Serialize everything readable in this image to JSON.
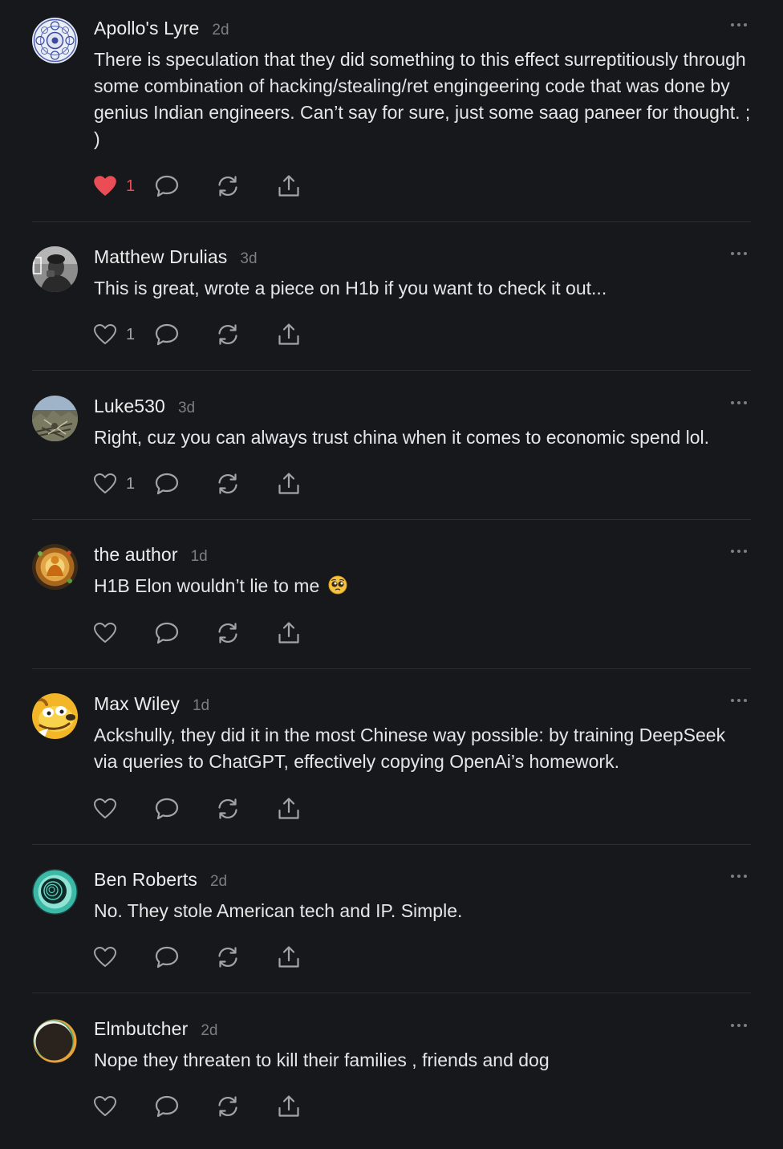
{
  "comments": [
    {
      "author": "Apollo's Lyre",
      "time": "2d",
      "text": "There is speculation that they did something to this effect surreptitiously through some combination of hacking/stealing/ret engingeering code that was done by genius Indian engineers. Can’t say for sure, just some saag paneer for thought. ; )",
      "likes": "1",
      "liked": true,
      "avatar": "mandala-avatar"
    },
    {
      "author": "Matthew Drulias",
      "time": "3d",
      "text": "This is great, wrote a piece on H1b if you want to check it out...",
      "likes": "1",
      "liked": false,
      "avatar": "bw-photo-avatar"
    },
    {
      "author": "Luke530",
      "time": "3d",
      "text": "Right, cuz you can always trust china when it comes to economic spend lol.",
      "likes": "1",
      "liked": false,
      "avatar": "landscape-avatar"
    },
    {
      "author": "the author",
      "time": "1d",
      "text": "H1B Elon wouldn’t lie to me",
      "emoji": "pleading-face-emoji",
      "likes": "",
      "liked": false,
      "avatar": "buddha-avatar"
    },
    {
      "author": "Max Wiley",
      "time": "1d",
      "text": "Ackshully, they did it in the most Chinese way possible: by training DeepSeek via queries to ChatGPT, effectively copying OpenAi’s homework.",
      "likes": "",
      "liked": false,
      "avatar": "cartoon-dog-avatar"
    },
    {
      "author": "Ben Roberts",
      "time": "2d",
      "text": "No. They stole American tech and IP. Simple.",
      "likes": "",
      "liked": false,
      "avatar": "teal-spiral-avatar"
    },
    {
      "author": "Elmbutcher",
      "time": "2d",
      "text": "Nope they threaten to kill their families , friends and dog",
      "likes": "",
      "liked": false,
      "avatar": "eclipse-avatar"
    }
  ],
  "colors": {
    "background": "#17181b",
    "like_active": "#ea4d55",
    "icon": "#a3a4a8",
    "timestamp": "#7d7e83"
  },
  "icons": {
    "like": "heart-icon",
    "reply": "speech-bubble-icon",
    "restack": "repost-icon",
    "share": "share-icon",
    "more": "more-dots-icon"
  }
}
